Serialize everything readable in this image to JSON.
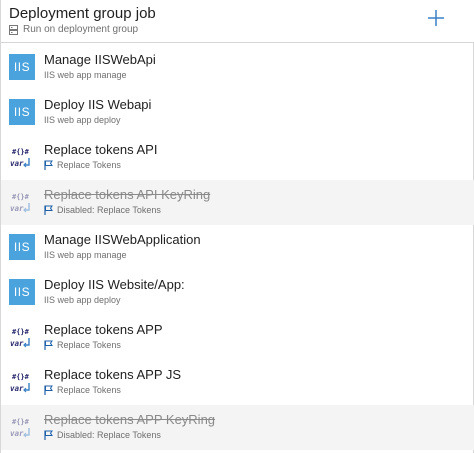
{
  "phase": {
    "title": "Deployment group job",
    "subtitle": "Run on deployment group",
    "icons": {
      "subtitle": "server-icon",
      "add": "plus-icon"
    }
  },
  "colors": {
    "iis_icon_bg": "#4aa3dd",
    "flag": "#1f5fa8",
    "disabled_row_bg": "#f4f4f4"
  },
  "tasks": [
    {
      "name": "Manage IISWebApi",
      "description": "IIS web app manage",
      "icon": "iis-icon",
      "icon_label": "IIS",
      "disabled": false
    },
    {
      "name": "Deploy IIS Webapi",
      "description": "IIS web app deploy",
      "icon": "iis-icon",
      "icon_label": "IIS",
      "disabled": false
    },
    {
      "name": "Replace tokens API",
      "description": "Replace Tokens",
      "icon": "replace-tokens-icon",
      "icon_label": "#{}#\nvar",
      "disabled": false
    },
    {
      "name": "Replace tokens API KeyRing",
      "description": "Disabled: Replace Tokens",
      "icon": "replace-tokens-icon",
      "icon_label": "#{}#\nvar",
      "disabled": true
    },
    {
      "name": "Manage IISWebApplication",
      "description": "IIS web app manage",
      "icon": "iis-icon",
      "icon_label": "IIS",
      "disabled": false
    },
    {
      "name": "Deploy IIS Website/App:",
      "description": "IIS web app deploy",
      "icon": "iis-icon",
      "icon_label": "IIS",
      "disabled": false
    },
    {
      "name": "Replace tokens APP",
      "description": "Replace Tokens",
      "icon": "replace-tokens-icon",
      "icon_label": "#{}#\nvar",
      "disabled": false
    },
    {
      "name": "Replace tokens APP JS",
      "description": "Replace Tokens",
      "icon": "replace-tokens-icon",
      "icon_label": "#{}#\nvar",
      "disabled": false
    },
    {
      "name": "Replace tokens APP KeyRing",
      "description": "Disabled: Replace Tokens",
      "icon": "replace-tokens-icon",
      "icon_label": "#{}#\nvar",
      "disabled": true
    }
  ]
}
